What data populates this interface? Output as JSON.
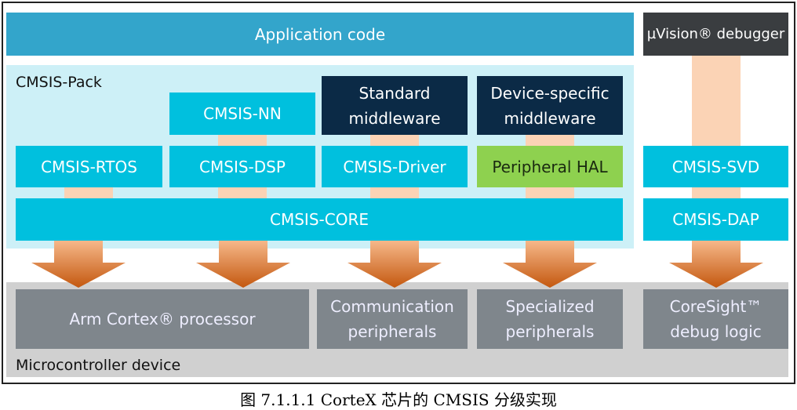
{
  "top": {
    "application": "Application code",
    "debugger": "µVision® debugger"
  },
  "pack": {
    "label": "CMSIS-Pack",
    "nn": "CMSIS-NN",
    "standard_mw": "Standard middleware",
    "device_mw": "Device-specific middleware",
    "rtos": "CMSIS-RTOS",
    "dsp": "CMSIS-DSP",
    "driver": "CMSIS-Driver",
    "hal": "Peripheral HAL",
    "core": "CMSIS-CORE"
  },
  "debug": {
    "svd": "CMSIS-SVD",
    "dap": "CMSIS-DAP"
  },
  "device": {
    "label": "Microcontroller device",
    "processor": "Arm Cortex® processor",
    "comm": "Communication peripherals",
    "special": "Specialized peripherals",
    "coresight": "CoreSight™ debug logic"
  },
  "caption": "图 7.1.1.1 CorteX 芯片的 CMSIS 分级实现",
  "colors": {
    "application": "#33a5cb",
    "cmsis": "#00c0de",
    "middleware": "#0b2a46",
    "hal": "#8ed14f",
    "pack_bg": "#cdf0f7",
    "device_bg": "#d0d0d0",
    "hardware": "#7f868c",
    "arrow": "#d9793a"
  }
}
